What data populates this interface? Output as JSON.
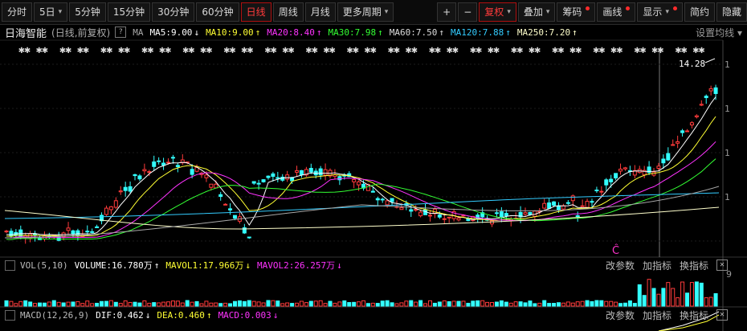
{
  "toolbar": {
    "periods": [
      {
        "label": "分时",
        "active": false
      },
      {
        "label": "5日",
        "active": false,
        "caret": "▾"
      },
      {
        "label": "5分钟",
        "active": false
      },
      {
        "label": "15分钟",
        "active": false
      },
      {
        "label": "30分钟",
        "active": false
      },
      {
        "label": "60分钟",
        "active": false
      },
      {
        "label": "日线",
        "active": true
      },
      {
        "label": "周线",
        "active": false
      },
      {
        "label": "月线",
        "active": false
      },
      {
        "label": "更多周期",
        "active": false,
        "caret": "▾"
      }
    ],
    "zoom_in": "+",
    "zoom_out": "−",
    "fuquan": "复权",
    "fuquan_caret": "▾",
    "diejia": "叠加",
    "diejia_caret": "▾",
    "chouma": "筹码",
    "huaxian": "画线",
    "xianshi": "显示",
    "xianshi_caret": "▾",
    "jianyue": "简约",
    "yincang": "隐藏"
  },
  "legend": {
    "stock_name": "日海智能",
    "mode": "(日线,前复权)",
    "help": "?",
    "ma_label": "MA",
    "ma_items": [
      {
        "text": "MA5:9.00",
        "arrow": "↓",
        "color": "#ffffff"
      },
      {
        "text": "MA10:9.00",
        "arrow": "↑",
        "color": "#ffff33"
      },
      {
        "text": "MA20:8.40",
        "arrow": "↑",
        "color": "#ff33ff"
      },
      {
        "text": "MA30:7.98",
        "arrow": "↑",
        "color": "#33ff33"
      },
      {
        "text": "MA60:7.50",
        "arrow": "↑",
        "color": "#dddddd"
      },
      {
        "text": "MA120:7.88",
        "arrow": "↑",
        "color": "#33ccff"
      },
      {
        "text": "MA250:7.20",
        "arrow": "↑",
        "color": "#ffffcc"
      }
    ],
    "settings": "设置均线",
    "settings_caret": "▾"
  },
  "price_label": "14.28",
  "signal_marker": "Ĉ",
  "vol_panel": {
    "name": "VOL(5,10)",
    "items": [
      {
        "text": "VOLUME:16.780万",
        "arrow": "↑",
        "color": "#ffffff"
      },
      {
        "text": "MAVOL1:17.966万",
        "arrow": "↓",
        "color": "#ffff33"
      },
      {
        "text": "MAVOL2:26.257万",
        "arrow": "↓",
        "color": "#ff33ff"
      }
    ],
    "buttons": [
      "改参数",
      "加指标",
      "换指标"
    ],
    "close": "✕",
    "axis_label": "9"
  },
  "macd_panel": {
    "name": "MACD(12,26,9)",
    "items": [
      {
        "text": "DIF:0.462",
        "arrow": "↓",
        "color": "#ffffff"
      },
      {
        "text": "DEA:0.460",
        "arrow": "↑",
        "color": "#ffff33"
      },
      {
        "text": "MACD:0.003",
        "arrow": "↓",
        "color": "#ff33ff"
      }
    ],
    "buttons": [
      "改参数",
      "加指标",
      "换指标"
    ],
    "close": "✕"
  },
  "colors": {
    "up": "#ff3b3b",
    "down": "#33ffff",
    "ma5": "#ffffff",
    "ma10": "#ffff33",
    "ma20": "#ff33ff",
    "ma30": "#33ff33",
    "ma60": "#aaaaaa",
    "ma120": "#33ccff",
    "ma250": "#ffffcc"
  }
}
